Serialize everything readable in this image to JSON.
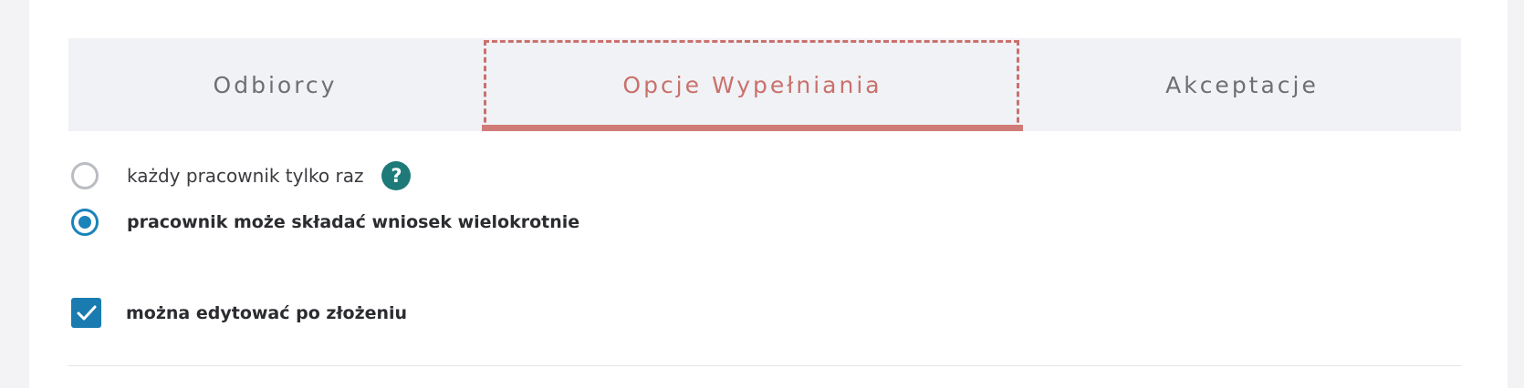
{
  "tabs": [
    {
      "label": "Odbiorcy",
      "active": false
    },
    {
      "label": "Opcje Wypełniania",
      "active": true
    },
    {
      "label": "Akceptacje",
      "active": false
    }
  ],
  "options": {
    "radio_once": {
      "label": "każdy pracownik tylko raz",
      "checked": false,
      "help_icon": "question-mark"
    },
    "radio_multiple": {
      "label": "pracownik może składać wniosek wielokrotnie",
      "checked": true
    },
    "checkbox_edit": {
      "label": "można edytować po złożeniu",
      "checked": true
    }
  },
  "help_glyph": "?",
  "colors": {
    "accent": "#d07b77",
    "radio": "#1a83b9",
    "checkbox": "#1a7bb0",
    "help": "#1d7a78",
    "tab_bg": "#f1f2f5"
  }
}
